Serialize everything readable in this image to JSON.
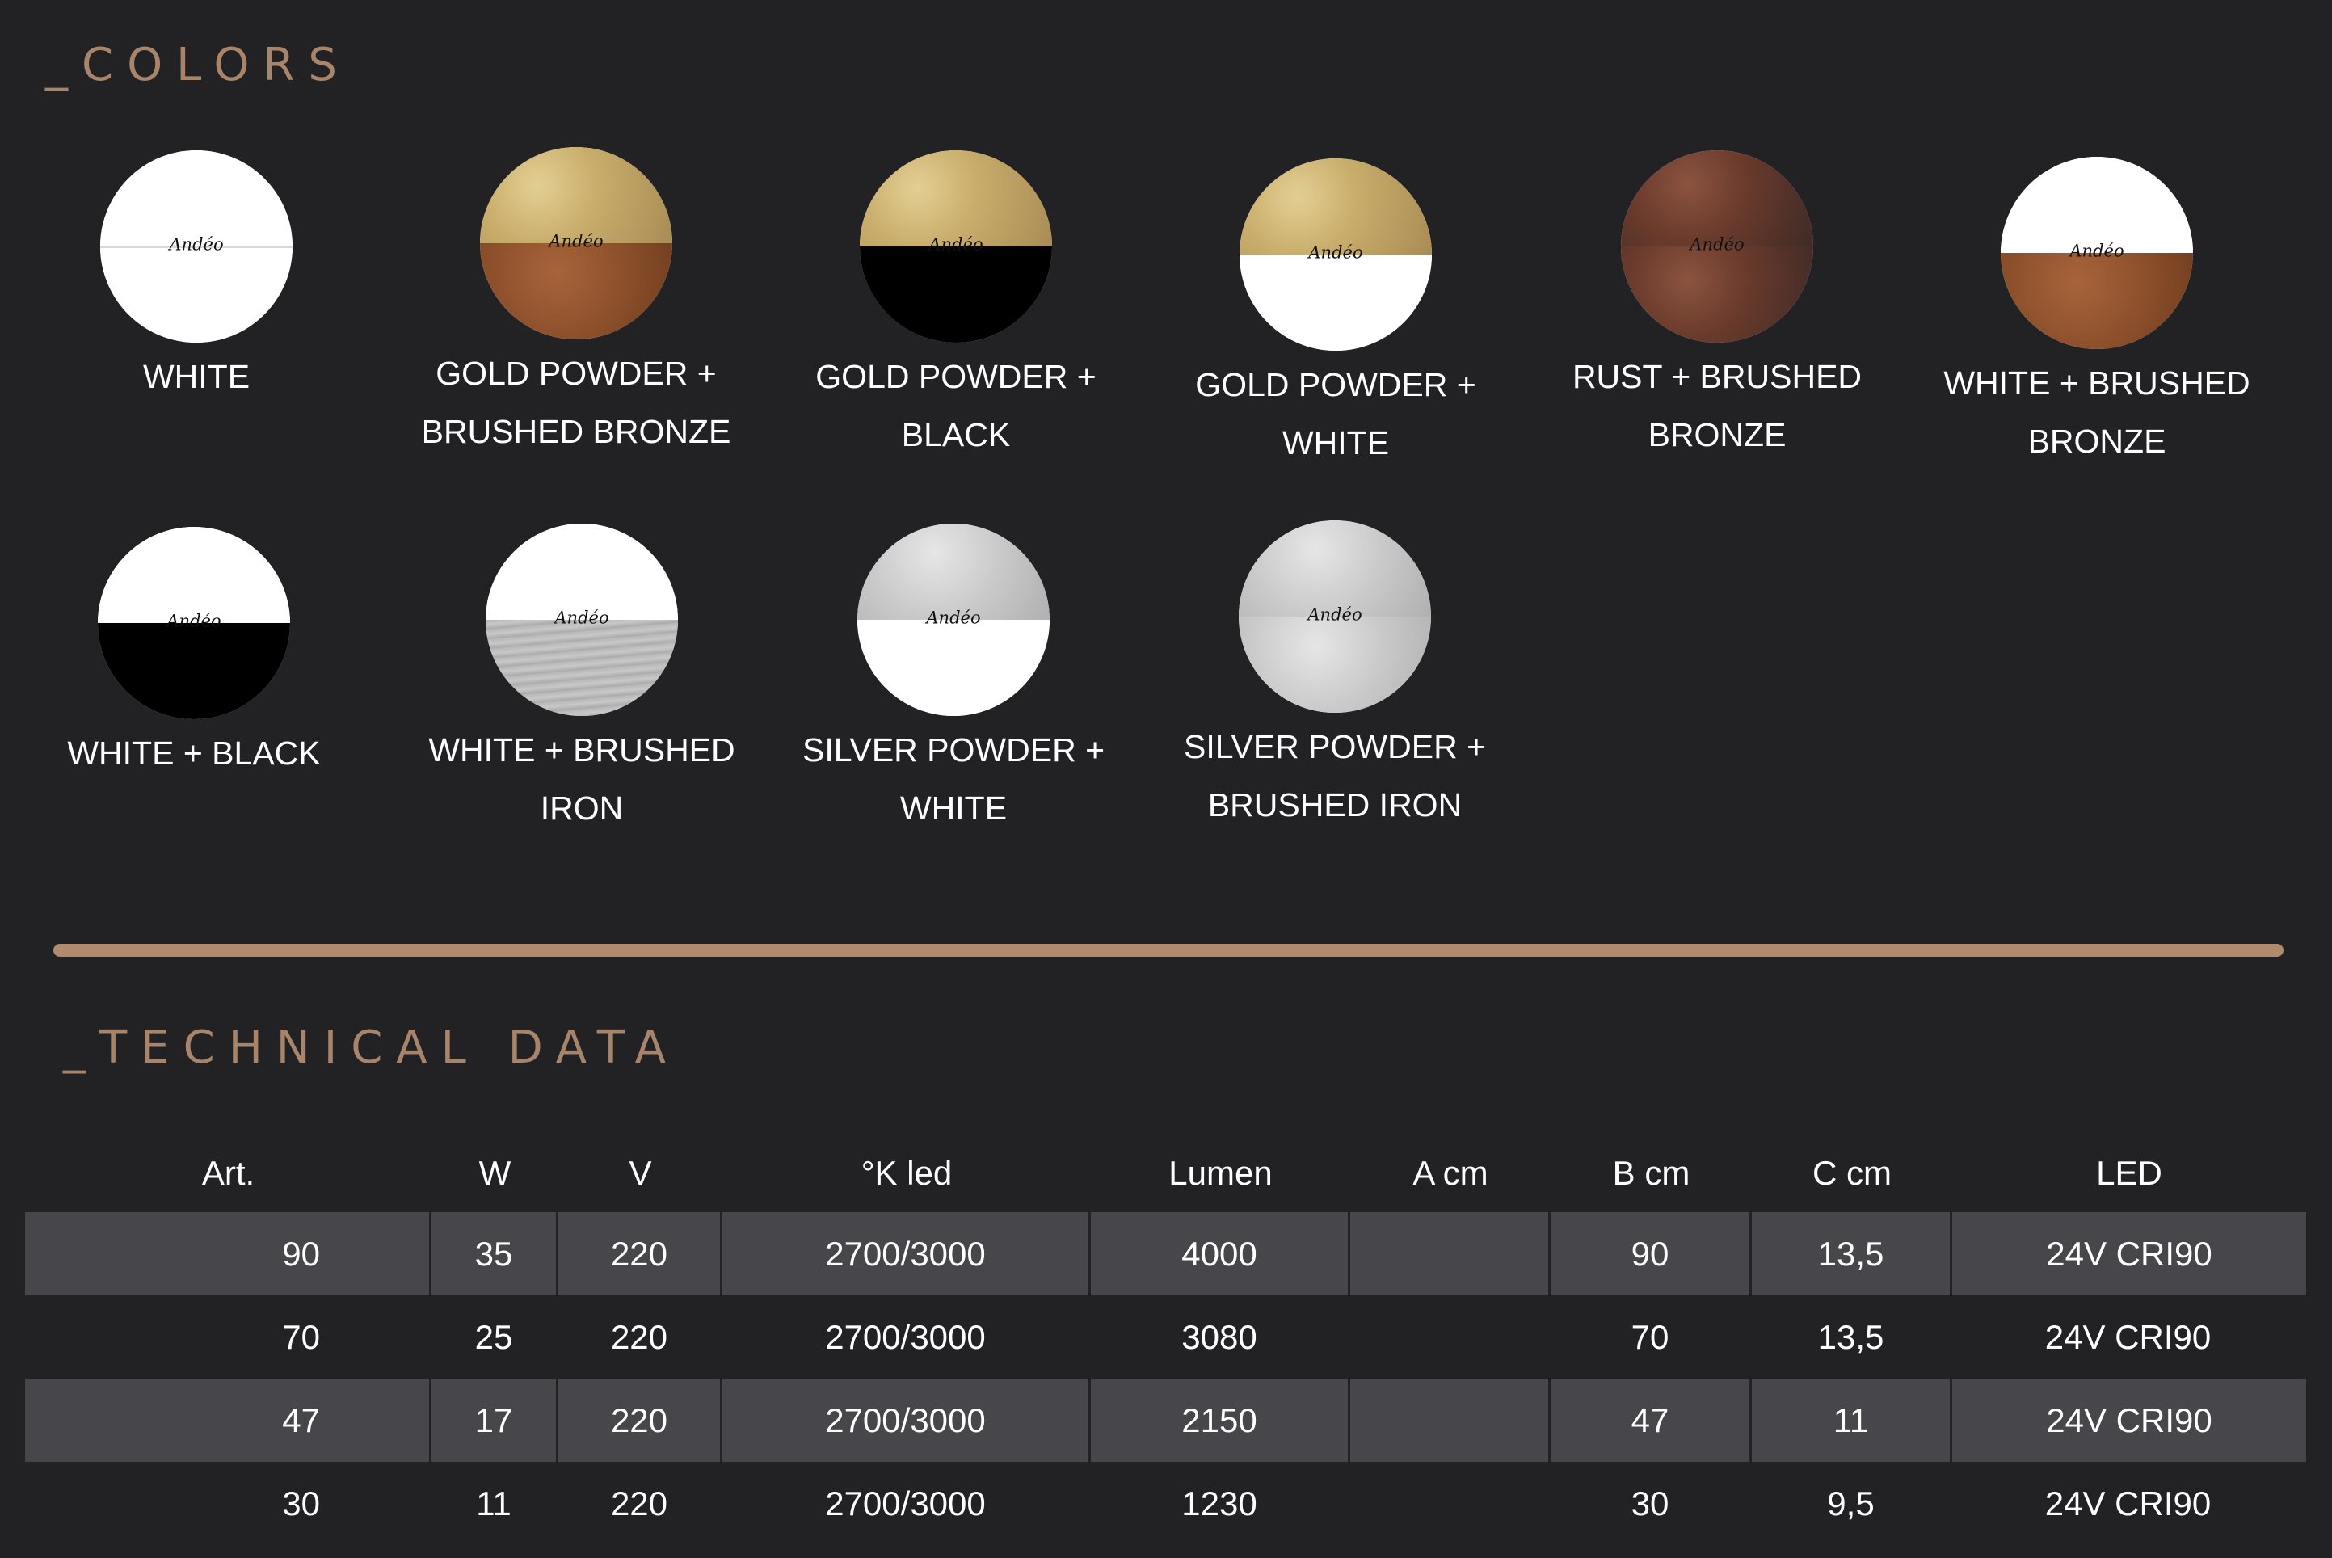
{
  "colors_section": {
    "title": "_COLORS",
    "swatches": [
      {
        "label_line1": "WHITE",
        "label_line2": "",
        "brand": "Andéo",
        "top": "white",
        "bottom": "white"
      },
      {
        "label_line1": "GOLD POWDER +",
        "label_line2": "BRUSHED BRONZE",
        "brand": "Andéo",
        "top": "gold",
        "bottom": "bronze"
      },
      {
        "label_line1": "GOLD POWDER +",
        "label_line2": "BLACK",
        "brand": "Andéo",
        "top": "gold",
        "bottom": "black"
      },
      {
        "label_line1": "GOLD POWDER +",
        "label_line2": "WHITE",
        "brand": "Andéo",
        "top": "gold",
        "bottom": "white"
      },
      {
        "label_line1": "RUST + BRUSHED",
        "label_line2": "BRONZE",
        "brand": "Andéo",
        "top": "rust",
        "bottom": "rust"
      },
      {
        "label_line1": "WHITE + BRUSHED",
        "label_line2": "BRONZE",
        "brand": "Andéo",
        "top": "white",
        "bottom": "bronze"
      },
      {
        "label_line1": "WHITE +  BLACK",
        "label_line2": "",
        "brand": "Andéo",
        "top": "white",
        "bottom": "black"
      },
      {
        "label_line1": "WHITE +  BRUSHED",
        "label_line2": "IRON",
        "brand": "Andéo",
        "top": "white",
        "bottom": "iron"
      },
      {
        "label_line1": "SILVER POWDER +",
        "label_line2": "WHITE",
        "brand": "Andéo",
        "top": "silver",
        "bottom": "white"
      },
      {
        "label_line1": "SILVER POWDER +",
        "label_line2": "BRUSHED IRON",
        "brand": "Andéo",
        "top": "silver",
        "bottom": "silver"
      }
    ]
  },
  "tech_section": {
    "title": "_TECHNICAL DATA",
    "headers": [
      "Art.",
      "W",
      "V",
      "°K led",
      "Lumen",
      "A cm",
      "B cm",
      "C cm",
      "LED"
    ],
    "rows": [
      [
        "90",
        "35",
        "220",
        "2700/3000",
        "4000",
        "",
        "90",
        "13,5",
        "24V CRI90"
      ],
      [
        "70",
        "25",
        "220",
        "2700/3000",
        "3080",
        "",
        "70",
        "13,5",
        "24V CRI90"
      ],
      [
        "47",
        "17",
        "220",
        "2700/3000",
        "2150",
        "",
        "47",
        "11",
        "24V CRI90"
      ],
      [
        "30",
        "11",
        "220",
        "2700/3000",
        "1230",
        "",
        "30",
        "9,5",
        "24V CRI90"
      ]
    ]
  },
  "theme": {
    "background": "#222224",
    "accent": "#b08b6c",
    "row_shade": "#47474b"
  }
}
